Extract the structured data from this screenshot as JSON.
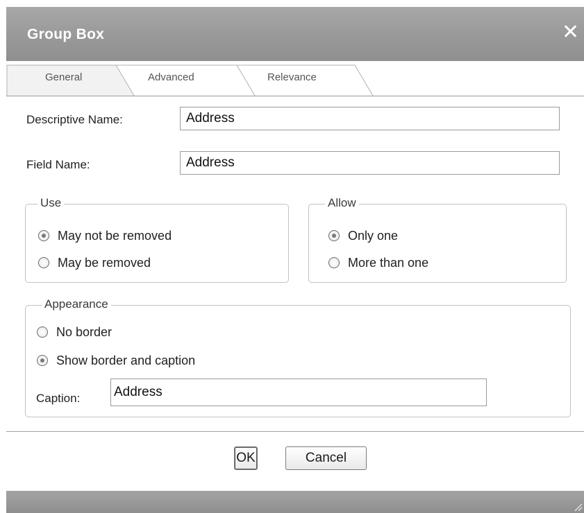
{
  "dialog": {
    "title": "Group Box",
    "close_icon": "close-icon"
  },
  "tabs": [
    {
      "label": "General",
      "active": true
    },
    {
      "label": "Advanced",
      "active": false
    },
    {
      "label": "Relevance",
      "active": false
    }
  ],
  "form": {
    "descriptive_name_label": "Descriptive Name:",
    "descriptive_name_value": "Address",
    "field_name_label": "Field Name:",
    "field_name_value": "Address"
  },
  "use_group": {
    "legend": "Use",
    "options": [
      {
        "label": "May not be removed",
        "checked": true
      },
      {
        "label": "May be removed",
        "checked": false
      }
    ]
  },
  "allow_group": {
    "legend": "Allow",
    "options": [
      {
        "label": "Only one",
        "checked": true
      },
      {
        "label": "More than one",
        "checked": false
      }
    ]
  },
  "appearance_group": {
    "legend": "Appearance",
    "options": [
      {
        "label": "No border",
        "checked": false
      },
      {
        "label": "Show border and caption",
        "checked": true
      }
    ],
    "caption_label": "Caption:",
    "caption_value": "Address"
  },
  "buttons": {
    "ok": "OK",
    "cancel": "Cancel"
  },
  "colors": {
    "titlebar": "#9a9a9a",
    "title_text": "#ffffff",
    "border": "#c2c2c2"
  }
}
